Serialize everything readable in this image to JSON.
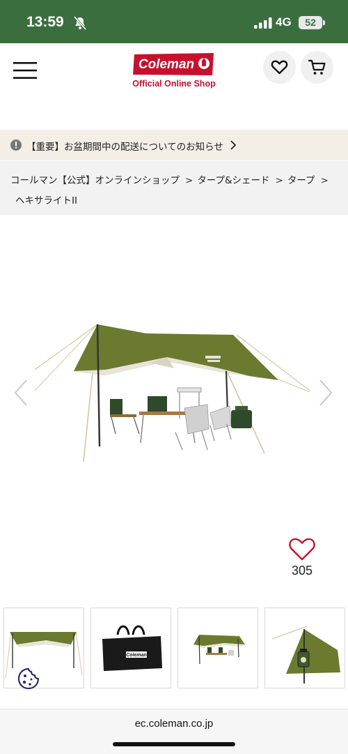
{
  "status_bar": {
    "time": "13:59",
    "network": "4G",
    "battery": "52"
  },
  "header": {
    "logo_text": "Coleman",
    "logo_subtitle": "Official Online Shop"
  },
  "notice": {
    "text": "【重要】お盆期間中の配送についてのお知らせ"
  },
  "breadcrumb": {
    "items": [
      "コールマン【公式】オンラインショップ",
      "タープ&シェード",
      "タープ"
    ],
    "current": "ヘキサライトII"
  },
  "product": {
    "like_count": "305"
  },
  "thumbnails": [
    {
      "name": "hexa-tarp-side"
    },
    {
      "name": "carry-bag",
      "bag_label": "Coleman"
    },
    {
      "name": "tarp-with-furniture"
    },
    {
      "name": "tarp-closeup-lantern"
    }
  ],
  "browser": {
    "url": "ec.coleman.co.jp"
  },
  "colors": {
    "status_green": "#3b6e3f",
    "brand_red": "#c8102e",
    "tarp_olive": "#6b7a2f"
  }
}
